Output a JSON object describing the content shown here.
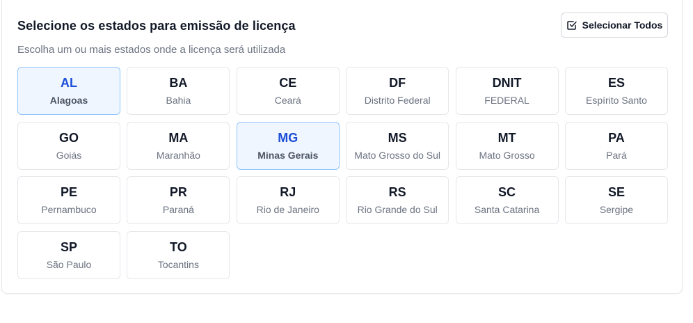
{
  "header": {
    "title": "Selecione os estados para emissão de licença",
    "subtitle": "Escolha um ou mais estados onde a licença será utilizada",
    "select_all_label": "Selecionar Todos",
    "select_all_icon": "checkbox-checked-icon"
  },
  "colors": {
    "selected_bg": "#eff6ff",
    "selected_border": "#93c5fd",
    "selected_text": "#1d4ed8"
  },
  "states": [
    {
      "code": "AL",
      "name": "Alagoas",
      "selected": true
    },
    {
      "code": "BA",
      "name": "Bahia",
      "selected": false
    },
    {
      "code": "CE",
      "name": "Ceará",
      "selected": false
    },
    {
      "code": "DF",
      "name": "Distrito Federal",
      "selected": false
    },
    {
      "code": "DNIT",
      "name": "FEDERAL",
      "selected": false
    },
    {
      "code": "ES",
      "name": "Espírito Santo",
      "selected": false
    },
    {
      "code": "GO",
      "name": "Goiás",
      "selected": false
    },
    {
      "code": "MA",
      "name": "Maranhão",
      "selected": false
    },
    {
      "code": "MG",
      "name": "Minas Gerais",
      "selected": true
    },
    {
      "code": "MS",
      "name": "Mato Grosso do Sul",
      "selected": false
    },
    {
      "code": "MT",
      "name": "Mato Grosso",
      "selected": false
    },
    {
      "code": "PA",
      "name": "Pará",
      "selected": false
    },
    {
      "code": "PE",
      "name": "Pernambuco",
      "selected": false
    },
    {
      "code": "PR",
      "name": "Paraná",
      "selected": false
    },
    {
      "code": "RJ",
      "name": "Rio de Janeiro",
      "selected": false
    },
    {
      "code": "RS",
      "name": "Rio Grande do Sul",
      "selected": false
    },
    {
      "code": "SC",
      "name": "Santa Catarina",
      "selected": false
    },
    {
      "code": "SE",
      "name": "Sergipe",
      "selected": false
    },
    {
      "code": "SP",
      "name": "São Paulo",
      "selected": false
    },
    {
      "code": "TO",
      "name": "Tocantins",
      "selected": false
    }
  ]
}
